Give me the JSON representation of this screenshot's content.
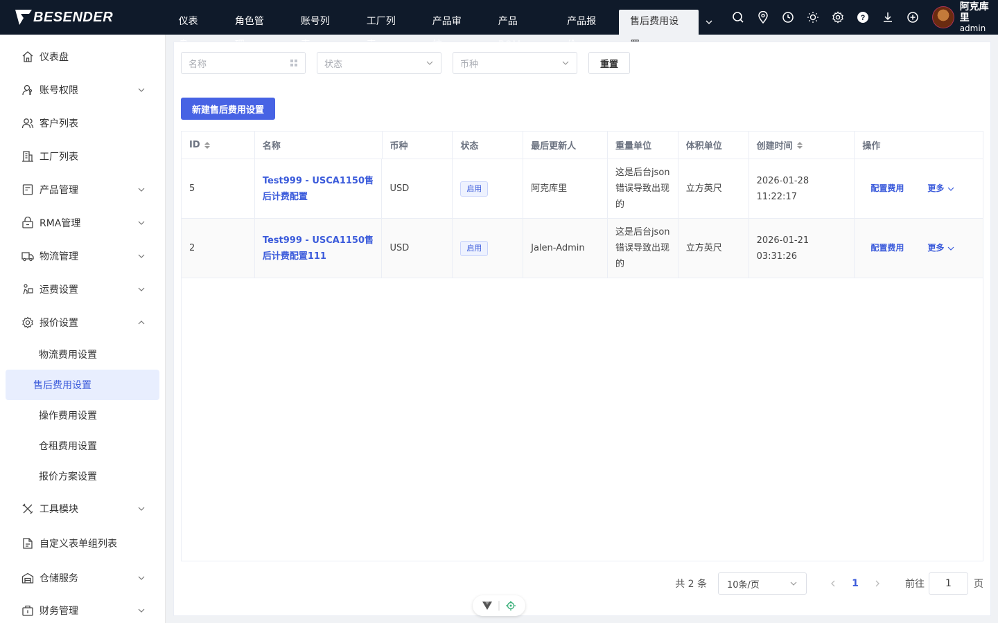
{
  "brand": {
    "name": "BESENDER"
  },
  "topnav": {
    "items": [
      "仪表盘",
      "角色管理",
      "账号列表",
      "工厂列表",
      "产品审核",
      "产品BOM",
      "产品报价",
      "售后费用设置"
    ],
    "active": "售后费用设置"
  },
  "user": {
    "name": "阿克库里",
    "role": "admin"
  },
  "sidebar": {
    "items": [
      {
        "label": "仪表盘",
        "icon": "home-icon"
      },
      {
        "label": "账号权限",
        "icon": "user-key-icon"
      },
      {
        "label": "客户列表",
        "icon": "users-icon"
      },
      {
        "label": "工厂列表",
        "icon": "building-icon"
      },
      {
        "label": "产品管理",
        "icon": "box-icon"
      },
      {
        "label": "RMA管理",
        "icon": "lock-box-icon"
      },
      {
        "label": "物流管理",
        "icon": "truck-icon"
      },
      {
        "label": "运费设置",
        "icon": "delivery-icon"
      },
      {
        "label": "报价设置",
        "icon": "gear-icon"
      }
    ],
    "sub_items": [
      "物流费用设置",
      "售后费用设置",
      "操作费用设置",
      "仓租费用设置",
      "报价方案设置"
    ],
    "items_after": [
      {
        "label": "工具模块",
        "icon": "tools-icon"
      },
      {
        "label": "自定义表单组列表",
        "icon": "form-icon"
      },
      {
        "label": "仓储服务",
        "icon": "warehouse-icon"
      },
      {
        "label": "财务管理",
        "icon": "finance-icon"
      }
    ]
  },
  "filters": {
    "name_placeholder": "名称",
    "status_placeholder": "状态",
    "currency_placeholder": "币种",
    "reset_label": "重置"
  },
  "create_button": "新建售后费用设置",
  "table": {
    "headers": [
      "ID",
      "名称",
      "币种",
      "状态",
      "最后更新人",
      "重量单位",
      "体积单位",
      "创建时间",
      "操作"
    ],
    "rows": [
      {
        "id": "5",
        "name": "Test999 - USCA1150售后计费配置",
        "currency": "USD",
        "status": "启用",
        "updater": "阿克库里",
        "weight_unit": "这是后台json错误导致出现的",
        "volume_unit": "立方英尺",
        "created": "2026-01-28 11:22:17",
        "op1": "配置费用",
        "op2": "更多"
      },
      {
        "id": "2",
        "name": "Test999 - USCA1150售后计费配置111",
        "currency": "USD",
        "status": "启用",
        "updater": "Jalen-Admin",
        "weight_unit": "这是后台json错误导致出现的",
        "volume_unit": "立方英尺",
        "created": "2026-01-21 03:31:26",
        "op1": "配置费用",
        "op2": "更多"
      }
    ]
  },
  "pager": {
    "total": "共 2 条",
    "page_size": "10条/页",
    "current": "1",
    "goto_label": "前往",
    "goto_value": "1",
    "goto_unit": "页"
  }
}
